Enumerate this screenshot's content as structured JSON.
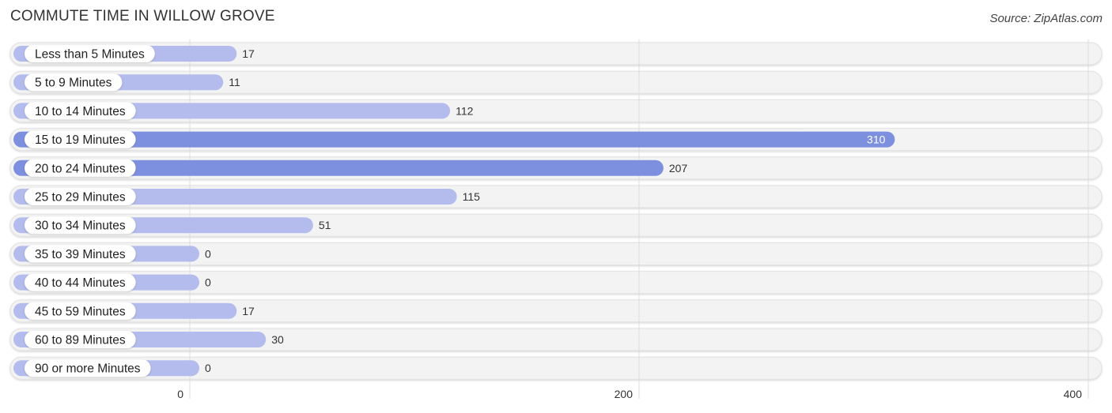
{
  "header": {
    "title": "COMMUTE TIME IN WILLOW GROVE",
    "source": "Source: ZipAtlas.com"
  },
  "colors": {
    "bar_normal": "#b3bcec",
    "bar_highlight": "#7d8fdf",
    "track": "#f3f3f3",
    "grid": "#dddddd"
  },
  "chart_data": {
    "type": "bar",
    "orientation": "horizontal",
    "title": "COMMUTE TIME IN WILLOW GROVE",
    "xlabel": "",
    "ylabel": "",
    "xlim": [
      0,
      400
    ],
    "xticks": [
      0,
      200,
      400
    ],
    "grid": true,
    "categories": [
      "Less than 5 Minutes",
      "5 to 9 Minutes",
      "10 to 14 Minutes",
      "15 to 19 Minutes",
      "20 to 24 Minutes",
      "25 to 29 Minutes",
      "30 to 34 Minutes",
      "35 to 39 Minutes",
      "40 to 44 Minutes",
      "45 to 59 Minutes",
      "60 to 89 Minutes",
      "90 or more Minutes"
    ],
    "values": [
      17,
      11,
      112,
      310,
      207,
      115,
      51,
      0,
      0,
      17,
      30,
      0
    ],
    "highlight_top": 2
  }
}
